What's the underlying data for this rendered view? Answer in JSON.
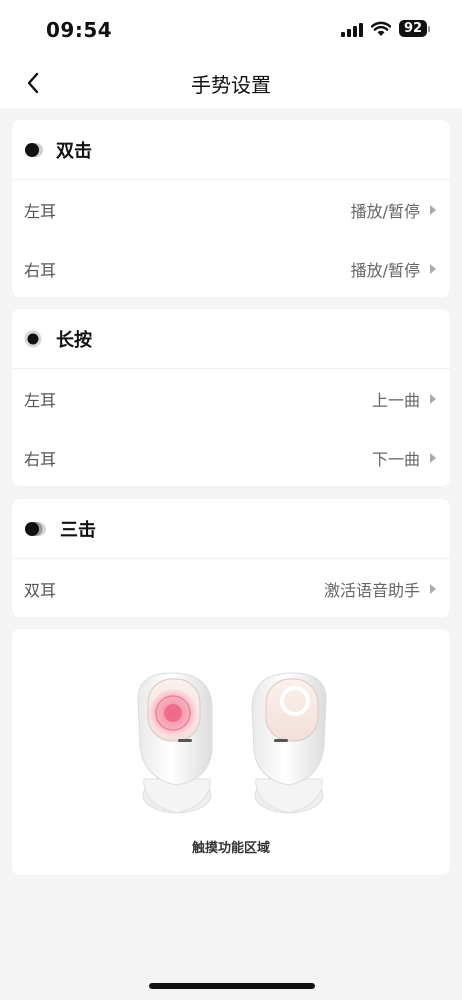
{
  "status_bar": {
    "time": "09:54",
    "battery": "92"
  },
  "nav": {
    "title": "手势设置"
  },
  "cards": [
    {
      "title": "双击",
      "rows": [
        {
          "label": "左耳",
          "value": "播放/暂停"
        },
        {
          "label": "右耳",
          "value": "播放/暂停"
        }
      ]
    },
    {
      "title": "长按",
      "rows": [
        {
          "label": "左耳",
          "value": "上一曲"
        },
        {
          "label": "右耳",
          "value": "下一曲"
        }
      ]
    },
    {
      "title": "三击",
      "rows": [
        {
          "label": "双耳",
          "value": "激活语音助手"
        }
      ]
    }
  ],
  "illustration": {
    "caption": "触摸功能区域"
  },
  "icons": {
    "back": "chevron-left-icon",
    "double_tap": "double-tap-icon",
    "long_press": "long-press-icon",
    "triple_tap": "triple-tap-icon",
    "signal": "cellular-signal-icon",
    "wifi": "wifi-icon",
    "battery": "battery-icon"
  },
  "colors": {
    "background": "#f4f4f4",
    "card": "#ffffff",
    "touch_highlight": "#f48aa0"
  }
}
